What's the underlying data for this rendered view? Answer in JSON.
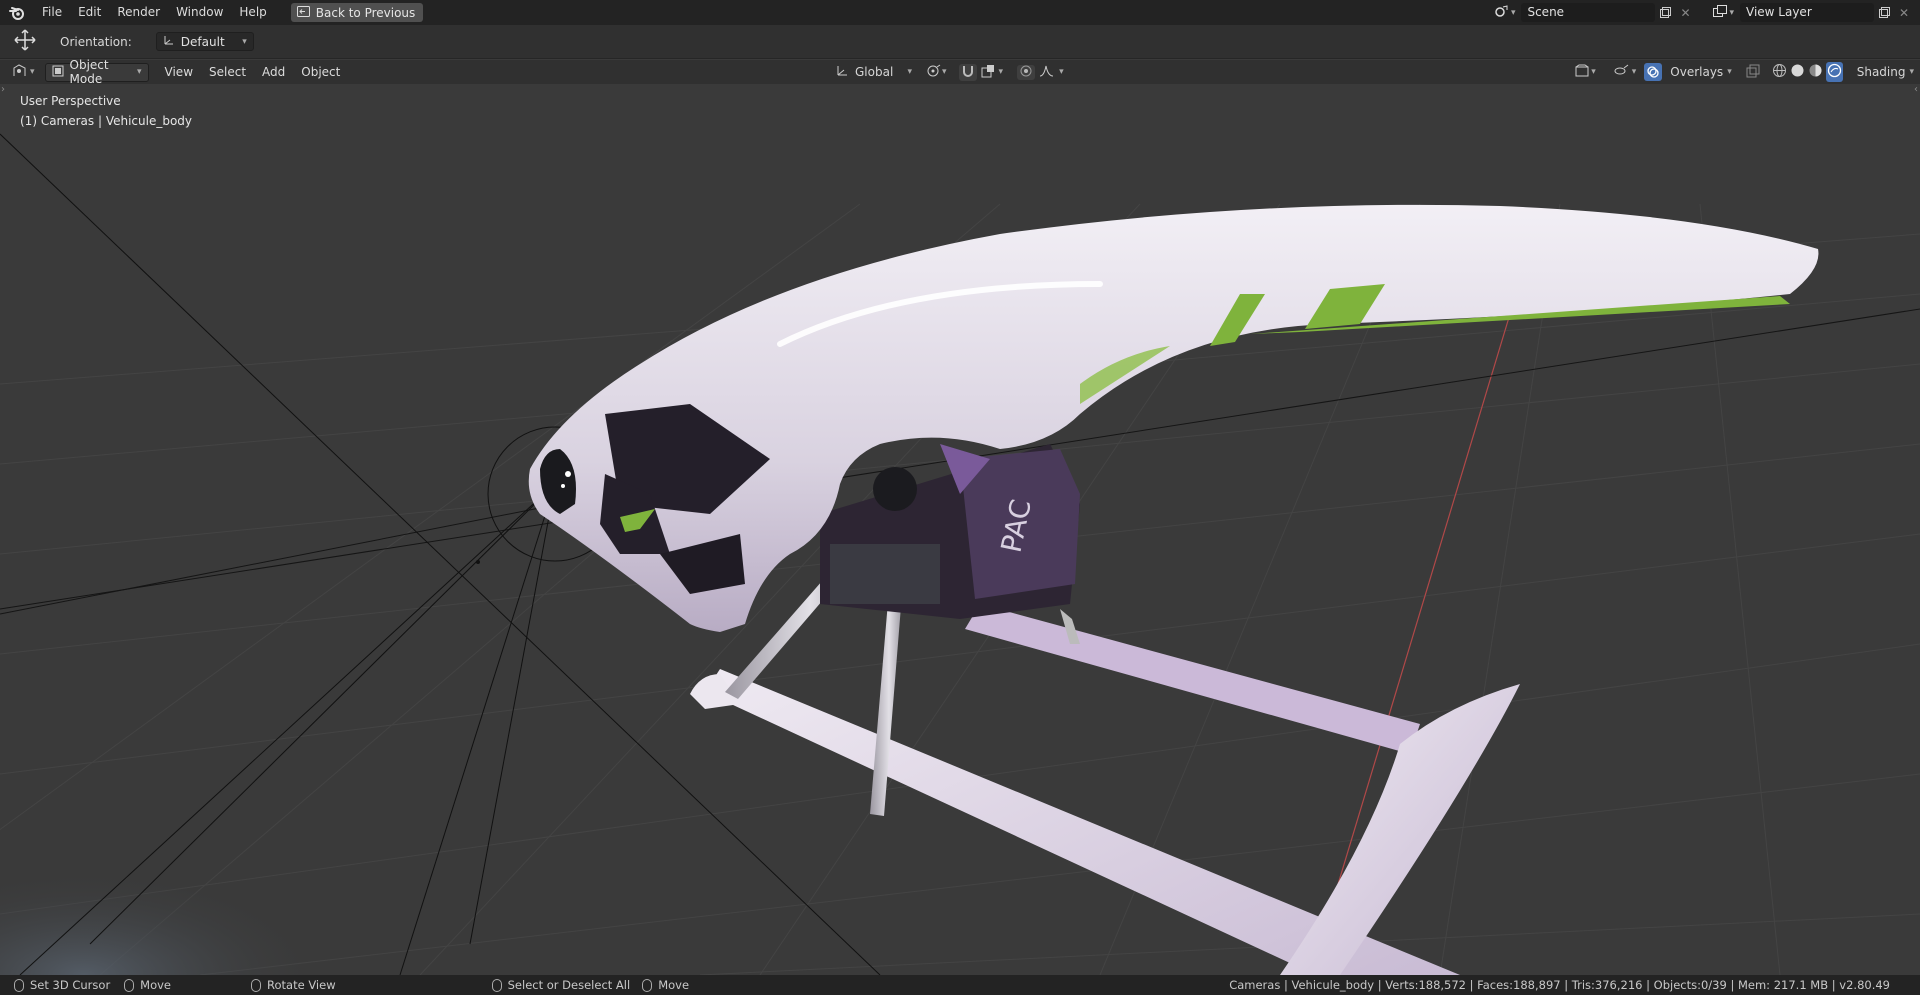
{
  "menubar": {
    "items": [
      "File",
      "Edit",
      "Render",
      "Window",
      "Help"
    ],
    "back_button": "Back to Previous",
    "scene_value": "Scene",
    "view_layer_value": "View Layer"
  },
  "toolheader": {
    "orientation_label": "Orientation:",
    "orientation_value": "Default"
  },
  "viewport_header": {
    "mode": "Object Mode",
    "menus": [
      "View",
      "Select",
      "Add",
      "Object"
    ],
    "transform_orientation": "Global",
    "overlays": "Overlays",
    "shading": "Shading"
  },
  "viewport": {
    "perspective": "User Perspective",
    "active_object": "(1) Cameras | Vehicule_body",
    "decal_text": "PAC",
    "colors": {
      "background": "#3a3a3a",
      "grid": "#454545",
      "body": "#e2dde6",
      "accent": "#7fb33c",
      "mechanism": "#4a3a5a",
      "x_axis": "#b04848"
    }
  },
  "statusbar": {
    "hints": [
      {
        "label": "Set 3D Cursor",
        "icon": "mouse-left-icon"
      },
      {
        "label": "Move",
        "icon": "mouse-middle-icon"
      },
      {
        "label": "Rotate View",
        "icon": "mouse-middle-icon"
      },
      {
        "label": "Select or Deselect All",
        "icon": "mouse-left-icon"
      },
      {
        "label": "Move",
        "icon": "mouse-right-icon"
      }
    ],
    "stats": "Cameras | Vehicule_body | Verts:188,572 | Faces:188,897 | Tris:376,216 | Objects:0/39 | Mem: 217.1 MB | v2.80.49"
  }
}
